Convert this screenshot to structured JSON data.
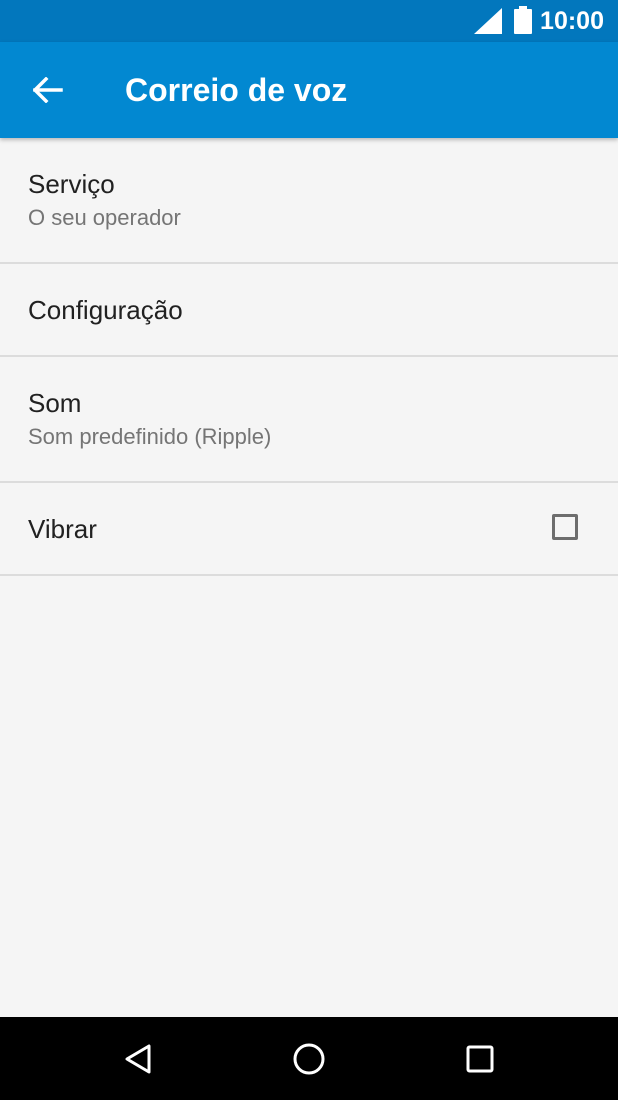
{
  "status_bar": {
    "time": "10:00",
    "icons": [
      "signal-icon",
      "battery-icon"
    ]
  },
  "app_bar": {
    "title": "Correio de voz",
    "back_icon": "arrow-back-icon"
  },
  "settings": {
    "items": [
      {
        "label": "Serviço",
        "summary": "O seu operador"
      },
      {
        "label": "Configuração"
      },
      {
        "label": "Som",
        "summary": "Som predefinido (Ripple)"
      },
      {
        "label": "Vibrar",
        "checked": false
      }
    ]
  },
  "nav_bar": {
    "icons": [
      "nav-back-icon",
      "nav-home-icon",
      "nav-recents-icon"
    ]
  },
  "colors": {
    "status_bar": "#0277bd",
    "app_bar": "#0288d1",
    "background": "#f5f5f5",
    "divider": "#dcdcdc",
    "primary_text": "#212121",
    "secondary_text": "#757575"
  }
}
